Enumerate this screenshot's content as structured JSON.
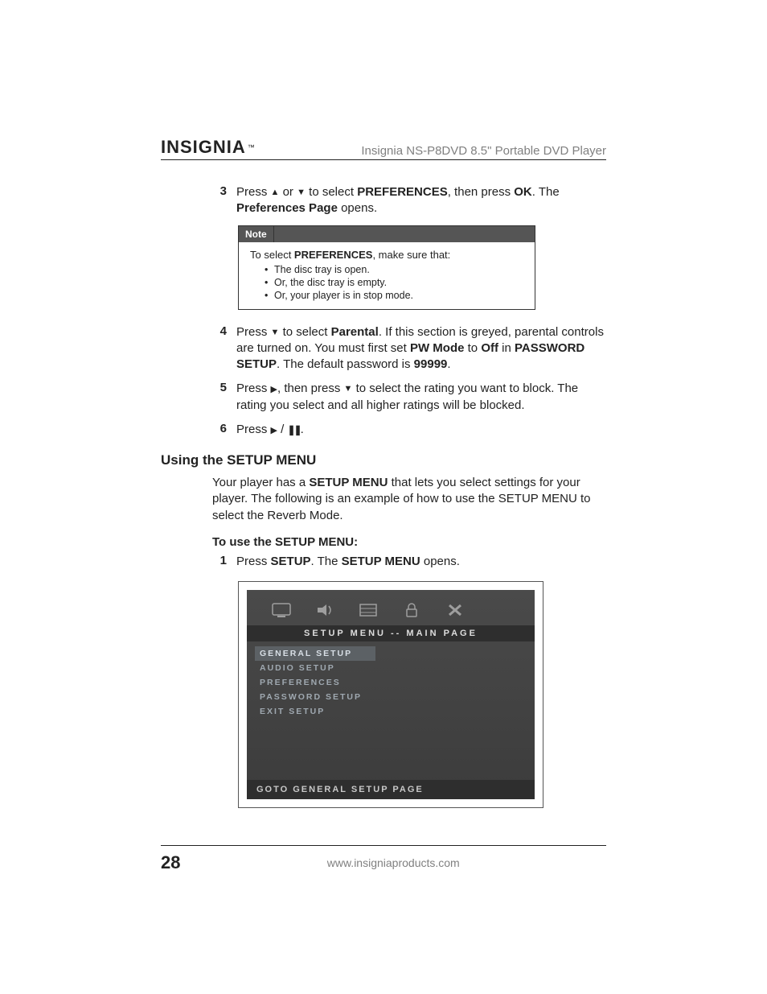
{
  "header": {
    "logo_text": "INSIGNIA",
    "logo_tm": "™",
    "product_title": "Insignia NS-P8DVD 8.5\" Portable DVD Player"
  },
  "steps_a": [
    {
      "num": "3",
      "pre": "Press ",
      "icon1": "▲",
      "mid1": " or ",
      "icon2": "▼",
      "mid2": " to select ",
      "bold1": "PREFERENCES",
      "mid3": ", then press ",
      "bold2": "OK",
      "mid4": ". The ",
      "bold3": "Preferences Page",
      "tail": " opens."
    }
  ],
  "note": {
    "label": "Note",
    "intro_pre": "To select ",
    "intro_bold": "PREFERENCES",
    "intro_post": ", make sure that:",
    "items": [
      "The disc tray is open.",
      "Or, the disc tray is empty.",
      "Or, your player is in stop mode."
    ]
  },
  "steps_b": [
    {
      "num": "4",
      "pre": "Press ",
      "icon1": "▼",
      "mid1": " to select ",
      "bold1": "Parental",
      "mid2": ". If this section is greyed, parental controls are turned on. You must first set ",
      "bold2": "PW Mode",
      "mid3": " to ",
      "bold3": "Off",
      "mid4": " in ",
      "bold4": "PASSWORD SETUP",
      "mid5": ". The default password is ",
      "bold5": "99999",
      "tail": "."
    },
    {
      "num": "5",
      "pre": "Press ",
      "icon1": "▶",
      "mid1": ", then press ",
      "icon2": "▼",
      "mid2": " to select the rating you want to block. The rating you select and all higher ratings will be blocked.",
      "bold1": "",
      "bold2": "",
      "mid3": "",
      "bold3": "",
      "mid4": "",
      "bold4": "",
      "mid5": "",
      "bold5": "",
      "tail": ""
    },
    {
      "num": "6",
      "pre": "Press ",
      "icon1": "▶",
      "mid1": " / ",
      "icon2": "❚❚",
      "mid2": ".",
      "bold1": "",
      "bold2": "",
      "mid3": "",
      "bold3": "",
      "mid4": "",
      "bold4": "",
      "mid5": "",
      "bold5": "",
      "tail": ""
    }
  ],
  "section": {
    "heading": "Using the SETUP MENU",
    "para_pre": "Your player has a ",
    "para_bold": "SETUP MENU",
    "para_post": " that lets you select settings for your player. The following is an example of how to use the SETUP MENU to select the Reverb Mode.",
    "sub_heading": "To use the SETUP MENU:"
  },
  "steps_c": [
    {
      "num": "1",
      "pre": "Press ",
      "bold1": "SETUP",
      "mid1": ". The ",
      "bold2": "SETUP MENU",
      "tail": " opens."
    }
  ],
  "screenshot": {
    "title": "SETUP MENU -- MAIN PAGE",
    "items": [
      "GENERAL SETUP",
      "AUDIO SETUP",
      "PREFERENCES",
      "PASSWORD SETUP",
      "EXIT SETUP"
    ],
    "footer": "GOTO GENERAL SETUP PAGE"
  },
  "footer": {
    "page_number": "28",
    "url": "www.insigniaproducts.com"
  }
}
